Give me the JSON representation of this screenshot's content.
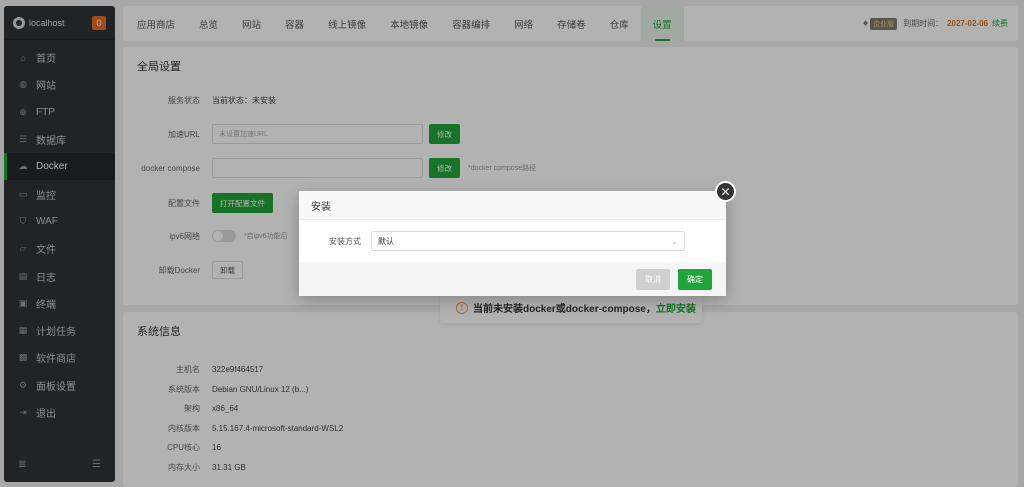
{
  "sidebar": {
    "host": "localhost",
    "badge": "0",
    "items": [
      {
        "label": "首页",
        "icon": "⌂"
      },
      {
        "label": "网站",
        "icon": "◍"
      },
      {
        "label": "FTP",
        "icon": "⊕"
      },
      {
        "label": "数据库",
        "icon": "☰"
      },
      {
        "label": "Docker",
        "icon": "☁"
      },
      {
        "label": "监控",
        "icon": "▭"
      },
      {
        "label": "WAF",
        "icon": "⛉"
      },
      {
        "label": "文件",
        "icon": "▱"
      },
      {
        "label": "日志",
        "icon": "▤"
      },
      {
        "label": "终端",
        "icon": "▣"
      },
      {
        "label": "计划任务",
        "icon": "▦"
      },
      {
        "label": "软件商店",
        "icon": "▩"
      },
      {
        "label": "面板设置",
        "icon": "⚙"
      },
      {
        "label": "退出",
        "icon": "⇥"
      }
    ],
    "active_index": 4,
    "bottom_left_icon": "≣",
    "bottom_right_icon": "☰"
  },
  "topbar": {
    "tabs": [
      "应用商店",
      "总览",
      "网站",
      "容器",
      "线上镜像",
      "本地镜像",
      "容器编排",
      "网络",
      "存储卷",
      "仓库",
      "设置"
    ],
    "active_tab": "设置",
    "edition": "企业版",
    "expire_label": "到期时间：",
    "expire_date": "2027-02-06",
    "renew": "续费"
  },
  "global": {
    "title": "全局设置",
    "service_label": "服务状态",
    "service_value": "当前状态：未安装",
    "accel_label": "加速URL",
    "accel_placeholder": "未设置加速URL",
    "accel_btn": "修改",
    "compose_label": "docker compose",
    "compose_btn": "修改",
    "compose_hint": "*docker compose路径",
    "config_label": "配置文件",
    "config_btn": "打开配置文件",
    "ipv6_label": "ipv6网络",
    "ipv6_hint": "*启ipv6功能后",
    "uninstall_label": "卸载Docker",
    "uninstall_btn": "卸载"
  },
  "notice": {
    "text": "当前未安装docker或docker-compose，",
    "link": "立即安装"
  },
  "sysinfo": {
    "title": "系统信息",
    "rows": [
      {
        "label": "主机名",
        "value": "322e9f464517"
      },
      {
        "label": "系统版本",
        "value": "Debian GNU/Linux 12 (b...)"
      },
      {
        "label": "架构",
        "value": "x86_64"
      },
      {
        "label": "内核版本",
        "value": "5.15.167.4-microsoft-standard-WSL2"
      },
      {
        "label": "CPU核心",
        "value": "16"
      },
      {
        "label": "内存大小",
        "value": "31.31 GB"
      }
    ]
  },
  "modal": {
    "title": "安装",
    "field_label": "安装方式",
    "selected": "默认",
    "cancel": "取消",
    "confirm": "确定"
  },
  "colors": {
    "accent": "#20a53a",
    "sidebar_bg": "#2f3437",
    "badge": "#ea6a2a",
    "date": "#e0701b"
  }
}
